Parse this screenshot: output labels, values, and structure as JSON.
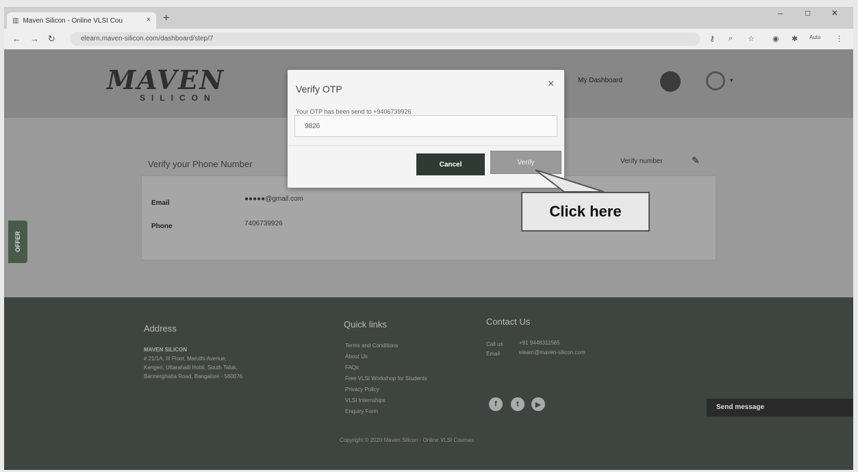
{
  "browser": {
    "tab_title": "Maven Silicon - Online VLSI Cou",
    "tab_close": "×",
    "new_tab": "+",
    "url": "elearn.maven-silicon.com/dashboard/step/7",
    "window_controls": [
      "–",
      "□",
      "✕"
    ],
    "profile_label": "Auto"
  },
  "header": {
    "logo_main": "MAVEN",
    "logo_sub": "SILICON",
    "dashboard_link": "My Dashboard"
  },
  "content": {
    "title": "Verify your Phone Number",
    "verify_number_link": "Verify number",
    "email_label": "Email",
    "email_value": "●●●●●@gmail.com",
    "phone_label": "Phone",
    "phone_value": "7406739926"
  },
  "offer_tab": "OFFER",
  "modal": {
    "title": "Verify OTP",
    "close": "×",
    "message": "Your OTP has been send to +9406739926",
    "otp_value": "9826",
    "cancel_label": "Cancel",
    "verify_label": "Verify"
  },
  "callout": {
    "text": "Click here"
  },
  "footer": {
    "address_heading": "Address",
    "address_company": "MAVEN SILICON",
    "address_lines": [
      "# 21/1A, III Floor, Maruthi Avenue,",
      "Kengeri, Uttarahalli Hobli, South Taluk,",
      "Bannerghatta Road, Bangalore - 560076"
    ],
    "quick_links_heading": "Quick links",
    "quick_links": [
      "Terms and Conditions",
      "About Us",
      "FAQs",
      "Free VLSI Workshop for Students",
      "Privacy Policy",
      "VLSI Internships",
      "Enquiry Form"
    ],
    "contact_heading": "Contact Us",
    "call_label": "Call us",
    "call_value": "+91 9448311565",
    "email_label": "Email",
    "email_value": "elearn@maven-silicon.com",
    "copyright": "Copyright © 2020 Maven Silicon - Online VLSI Courses",
    "send_message": "Send message"
  },
  "colors": {
    "footer_bg": "#3e4540",
    "cancel_button": "#2f3a34",
    "page_overlay": "#8b8b8b"
  }
}
